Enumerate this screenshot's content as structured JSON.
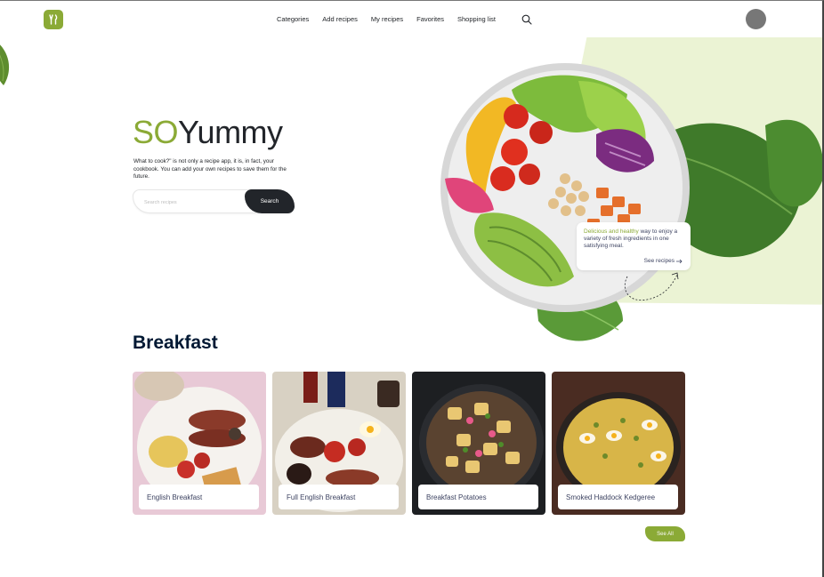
{
  "nav": {
    "items": [
      "Categories",
      "Add recipes",
      "My recipes",
      "Favorites",
      "Shopping list"
    ]
  },
  "hero": {
    "brand_accent": "SO",
    "brand_rest": "Yummy",
    "tagline": "What to cook?\" is not only a recipe app, it is, in fact, your cookbook. You can add your own recipes to save them for the future.",
    "search_placeholder": "Search recipes",
    "search_button": "Search"
  },
  "promo": {
    "highlight": "Delicious and healthy",
    "text": " way to enjoy a variety of fresh ingredients in one satisfying meal.",
    "link": "See recipes"
  },
  "section": {
    "title": "Breakfast",
    "cards": [
      {
        "label": "English Breakfast"
      },
      {
        "label": "Full English Breakfast"
      },
      {
        "label": "Breakfast Potatoes"
      },
      {
        "label": "Smoked Haddock Kedgeree"
      }
    ],
    "see_all": "See All"
  },
  "colors": {
    "accent": "#8baa36",
    "dark": "#22252a",
    "panel": "#ebf3d4"
  },
  "icons": [
    "logo-icon",
    "search-icon",
    "arrow-right-icon"
  ]
}
